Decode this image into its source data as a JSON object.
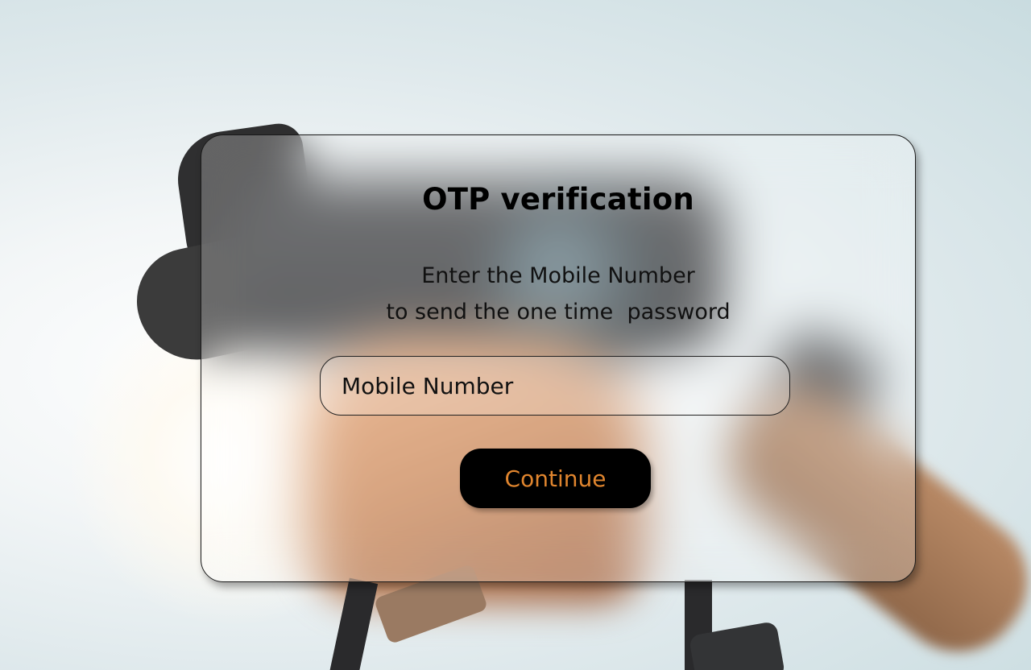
{
  "card": {
    "title": "OTP verification",
    "subtitle_line1": "Enter the Mobile Number",
    "subtitle_line2": "to send the one time  password"
  },
  "form": {
    "mobile_placeholder": "Mobile Number",
    "mobile_value": "",
    "continue_label": "Continue"
  },
  "colors": {
    "button_bg": "#000000",
    "button_text": "#e0852e",
    "title_text": "#000000"
  }
}
